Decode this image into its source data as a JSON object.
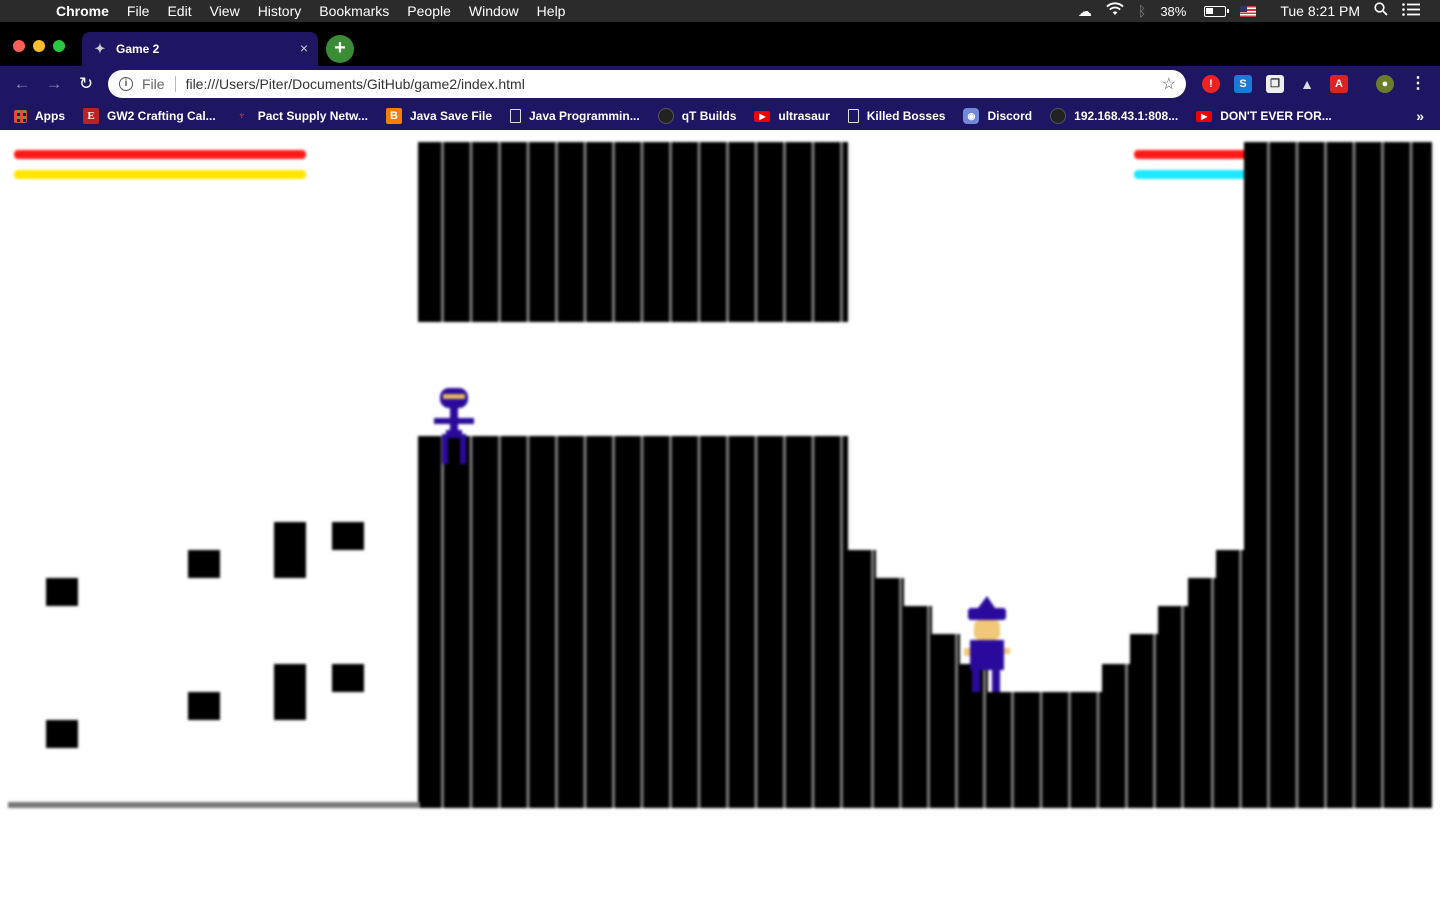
{
  "menubar": {
    "app_name": "Chrome",
    "menus": [
      "File",
      "Edit",
      "View",
      "History",
      "Bookmarks",
      "People",
      "Window",
      "Help"
    ],
    "battery_percent": "38%",
    "battery_level": 0.38,
    "clock": "Tue 8:21 PM"
  },
  "tab": {
    "title": "Game 2",
    "close_glyph": "×",
    "new_tab_glyph": "+"
  },
  "toolbar": {
    "scheme_label": "File",
    "url": "file:///Users/Piter/Documents/GitHub/game2/index.html"
  },
  "bookmarks": [
    {
      "label": "Apps",
      "icon": "apps-grid-icon"
    },
    {
      "label": "GW2 Crafting Cal...",
      "icon": "gw2-icon"
    },
    {
      "label": "Pact Supply Netw...",
      "icon": "pact-icon"
    },
    {
      "label": "Java Save File",
      "icon": "blogger-icon"
    },
    {
      "label": "Java Programmin...",
      "icon": "page-icon"
    },
    {
      "label": "qT Builds",
      "icon": "globe-icon"
    },
    {
      "label": "ultrasaur",
      "icon": "youtube-icon"
    },
    {
      "label": "Killed Bosses",
      "icon": "page-icon"
    },
    {
      "label": "Discord",
      "icon": "discord-icon"
    },
    {
      "label": "192.168.43.1:808...",
      "icon": "globe-icon"
    },
    {
      "label": "DON'T EVER FOR...",
      "icon": "youtube-icon"
    }
  ],
  "game": {
    "player1": {
      "health": 1.0,
      "energy": 1.0,
      "health_color": "#ff1a1a",
      "energy_color": "#ffe600"
    },
    "player2": {
      "health": 1.0,
      "mana": 1.0,
      "health_color": "#ff1a1a",
      "mana_color": "#1ee8ff"
    },
    "ninja_color": "#2a0a9a",
    "wizard_color": "#2a0a9a"
  },
  "colors": {
    "chrome_theme": "#1e1662",
    "tab_strip": "#000000"
  }
}
